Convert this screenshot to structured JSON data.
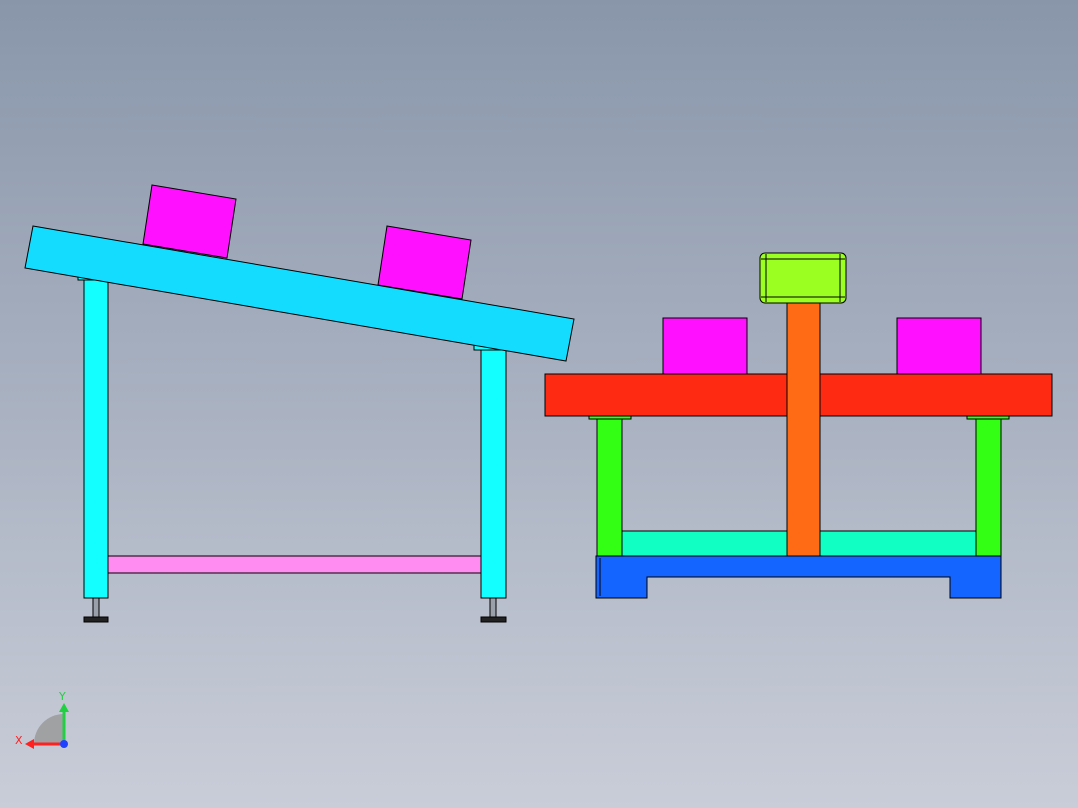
{
  "viewport": {
    "background_top": "#8996aa",
    "background_bottom": "#c9cdd8"
  },
  "colors": {
    "conveyor_frame": "#13dcff",
    "leg": "#13ffff",
    "crossbar": "#ff8cf0",
    "workpiece": "#ff10ff",
    "top_plate": "#ff2a12",
    "support_leg": "#32ff14",
    "lower_rail": "#12ffc4",
    "base": "#1464ff",
    "column": "#ff6a14",
    "cap_block": "#9cff22",
    "foot": "#222222"
  },
  "triad": {
    "x_label": "X",
    "y_label": "Y",
    "x_color": "#ff2020",
    "y_color": "#20d040",
    "z_color": "#2040ff"
  }
}
